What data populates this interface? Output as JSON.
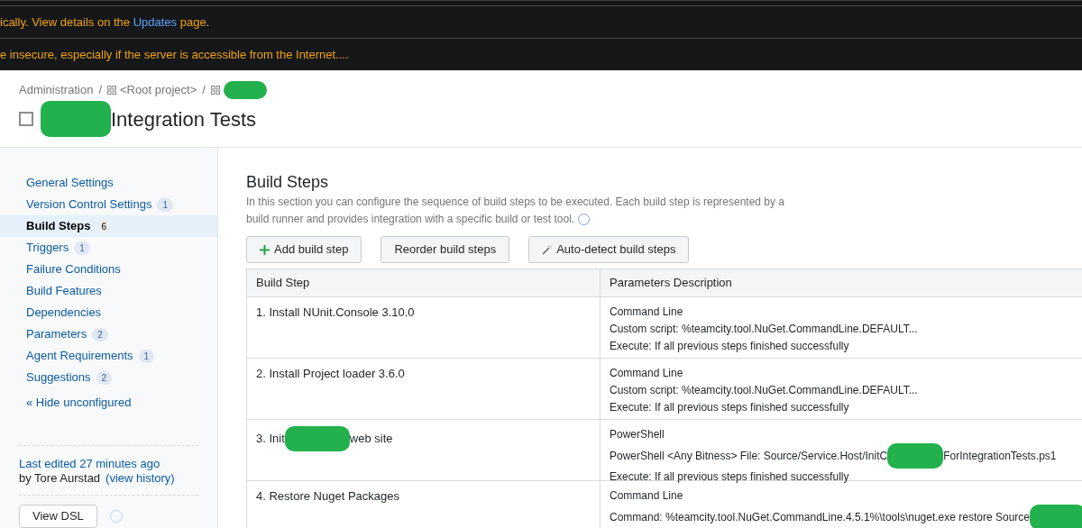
{
  "banners": [
    {
      "text": "ically. View details on the ",
      "link": "Updates",
      "after": " page."
    },
    {
      "text": "e insecure, especially if the server is accessible from the Internet...."
    }
  ],
  "breadcrumb": [
    {
      "kind": "link",
      "label": "Administration",
      "icon": false
    },
    {
      "kind": "separator",
      "label": "/"
    },
    {
      "kind": "link",
      "label": "<Root project>",
      "icon": true
    },
    {
      "kind": "separator",
      "label": "/"
    },
    {
      "kind": "redaction",
      "icon": true
    }
  ],
  "title": {
    "text": "Integration Tests",
    "redacted": true
  },
  "sidebar": {
    "items": [
      {
        "label": "General Settings",
        "selected": false
      },
      {
        "label": "Version Control Settings",
        "count": "1",
        "selected": false
      },
      {
        "label": "Build Steps",
        "count": "6",
        "selected": true
      },
      {
        "label": "Triggers",
        "count": "1",
        "selected": false
      },
      {
        "label": "Failure Conditions",
        "selected": false
      },
      {
        "label": "Build Features",
        "selected": false
      },
      {
        "label": "Dependencies",
        "selected": false
      },
      {
        "label": "Parameters",
        "count": "2",
        "selected": false
      },
      {
        "label": "Agent Requirements",
        "count": "1",
        "selected": false
      },
      {
        "label": "Suggestions",
        "count": "2",
        "selected": false
      }
    ],
    "hide_link": "« Hide unconfigured",
    "last_edited": "Last edited 27 minutes ago",
    "by": "by Tore Aurstad",
    "history_link": "(view history)",
    "dsl_button": "View DSL"
  },
  "section": {
    "title": "Build Steps",
    "description": "In this section you can configure the sequence of build steps to be executed. Each build step is represented by a build runner and provides integration with a specific build or test tool.",
    "buttons": [
      {
        "label": "Add build step",
        "kind": "add"
      },
      {
        "label": "Reorder build steps",
        "kind": "plain"
      },
      {
        "label": "Auto-detect build steps",
        "kind": "wand"
      }
    ]
  },
  "table": {
    "columns": [
      "Build Step",
      "Parameters Description"
    ],
    "rows": [
      {
        "step": [
          {
            "kind": "text",
            "text": "1. Install NUnit.Console 3.10.0"
          }
        ],
        "lines": [
          [
            {
              "kind": "text",
              "text": "Command Line"
            }
          ],
          [
            {
              "kind": "text",
              "text": "Custom script: %teamcity.tool.NuGet.CommandLine.DEFAULT..."
            }
          ],
          [
            {
              "kind": "text",
              "text": "Execute: If all previous steps finished successfully"
            }
          ]
        ]
      },
      {
        "step": [
          {
            "kind": "text",
            "text": "2. Install Project loader 3.6.0"
          }
        ],
        "lines": [
          [
            {
              "kind": "text",
              "text": "Command Line"
            }
          ],
          [
            {
              "kind": "text",
              "text": "Custom script: %teamcity.tool.NuGet.CommandLine.DEFAULT..."
            }
          ],
          [
            {
              "kind": "text",
              "text": "Execute: If all previous steps finished successfully"
            }
          ]
        ]
      },
      {
        "step": [
          {
            "kind": "text",
            "text": "3. Init"
          },
          {
            "kind": "redaction"
          },
          {
            "kind": "text",
            "text": "web site"
          }
        ],
        "lines": [
          [
            {
              "kind": "text",
              "text": "PowerShell"
            }
          ],
          [
            {
              "kind": "text",
              "text": "PowerShell <Any Bitness> File: Source/Service.Host/InitC"
            },
            {
              "kind": "redaction"
            },
            {
              "kind": "text",
              "text": "ForIntegrationTests.ps1"
            }
          ],
          [
            {
              "kind": "text",
              "text": "Execute: If all previous steps finished successfully"
            }
          ]
        ]
      },
      {
        "step": [
          {
            "kind": "text",
            "text": "4. Restore Nuget Packages"
          }
        ],
        "lines": [
          [
            {
              "kind": "text",
              "text": "Command Line"
            }
          ],
          [
            {
              "kind": "text",
              "text": "Command: %teamcity.tool.NuGet.CommandLine.4.5.1%\\tools\\nuget.exe restore Source"
            },
            {
              "kind": "redaction"
            }
          ]
        ]
      }
    ]
  }
}
